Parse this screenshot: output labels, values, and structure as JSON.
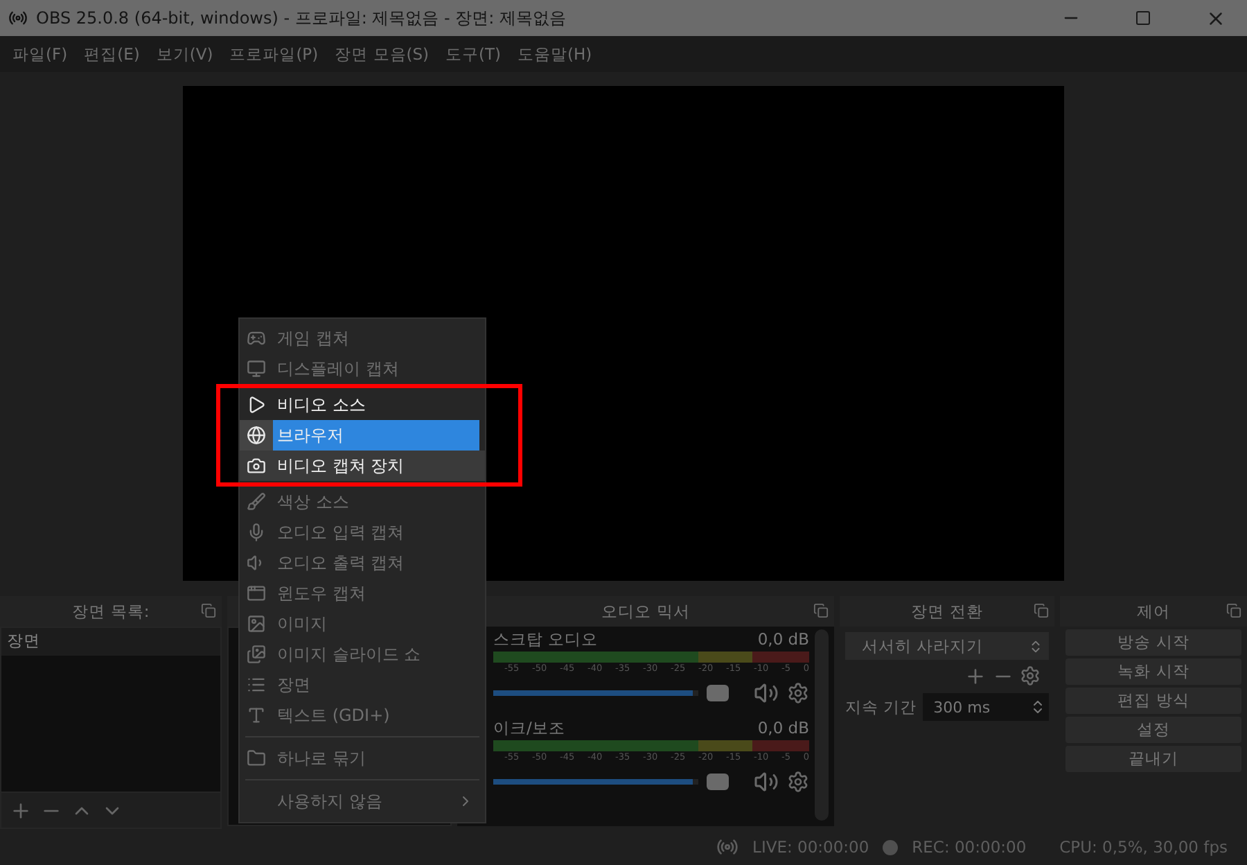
{
  "window": {
    "title": "OBS 25.0.8 (64-bit, windows) - 프로파일: 제목없음 - 장면: 제목없음"
  },
  "menu_bar": [
    "파일(F)",
    "편집(E)",
    "보기(V)",
    "프로파일(P)",
    "장면 모음(S)",
    "도구(T)",
    "도움말(H)"
  ],
  "scenes": {
    "title": "장면 목록:",
    "items": [
      {
        "label": "장면",
        "selected": true
      }
    ]
  },
  "add_source_menu": {
    "items": [
      {
        "kind": "item",
        "label": "게임 캡쳐",
        "lit": false,
        "hovered": false,
        "selected": false
      },
      {
        "kind": "item",
        "label": "디스플레이 캡쳐",
        "lit": false,
        "hovered": false,
        "selected": false
      },
      {
        "kind": "item",
        "label": "비디오 소스",
        "lit": true,
        "hovered": false,
        "selected": false
      },
      {
        "kind": "item",
        "label": "브라우저",
        "lit": true,
        "hovered": false,
        "selected": true
      },
      {
        "kind": "item",
        "label": "비디오 캡쳐 장치",
        "lit": true,
        "hovered": true,
        "selected": false
      },
      {
        "kind": "item",
        "label": "색상 소스",
        "lit": false,
        "hovered": false,
        "selected": false
      },
      {
        "kind": "item",
        "label": "오디오 입력 캡쳐",
        "lit": false,
        "hovered": false,
        "selected": false
      },
      {
        "kind": "item",
        "label": "오디오 출력 캡쳐",
        "lit": false,
        "hovered": false,
        "selected": false
      },
      {
        "kind": "item",
        "label": "윈도우 캡쳐",
        "lit": false,
        "hovered": false,
        "selected": false
      },
      {
        "kind": "item",
        "label": "이미지",
        "lit": false,
        "hovered": false,
        "selected": false
      },
      {
        "kind": "item",
        "label": "이미지 슬라이드 쇼",
        "lit": false,
        "hovered": false,
        "selected": false
      },
      {
        "kind": "item",
        "label": "장면",
        "lit": false,
        "hovered": false,
        "selected": false
      },
      {
        "kind": "item",
        "label": "텍스트 (GDI+)",
        "lit": false,
        "hovered": false,
        "selected": false
      },
      {
        "kind": "separator"
      },
      {
        "kind": "item",
        "label": "하나로 묶기",
        "lit": false,
        "hovered": false,
        "selected": false
      },
      {
        "kind": "separator"
      },
      {
        "kind": "submenu",
        "label": "사용하지 않음",
        "lit": false,
        "hovered": false,
        "selected": false
      }
    ]
  },
  "audio_mixer": {
    "title": "오디오 믹서",
    "channels": [
      {
        "name": "스크탑 오디오",
        "reading": "0,0 dB",
        "level": 0.97,
        "scale": [
          "-55",
          "-50",
          "-45",
          "-40",
          "-35",
          "-30",
          "-25",
          "-20",
          "-15",
          "-10",
          "-5",
          "0"
        ]
      },
      {
        "name": "이크/보조",
        "reading": "0,0 dB",
        "level": 0.97,
        "scale": [
          "-55",
          "-50",
          "-45",
          "-40",
          "-35",
          "-30",
          "-25",
          "-20",
          "-15",
          "-10",
          "-5",
          "0"
        ]
      }
    ]
  },
  "transitions": {
    "title": "장면 전환",
    "transition": "서서히 사라지기",
    "duration_label": "지속 기간",
    "duration": "300 ms"
  },
  "controls": {
    "title": "제어",
    "buttons": [
      "방송 시작",
      "녹화 시작",
      "편집 방식",
      "설정",
      "끝내기"
    ]
  },
  "status_bar": {
    "live": "LIVE: 00:00:00",
    "rec": "REC: 00:00:00",
    "cpu": "CPU: 0,5%, 30,00 fps"
  }
}
